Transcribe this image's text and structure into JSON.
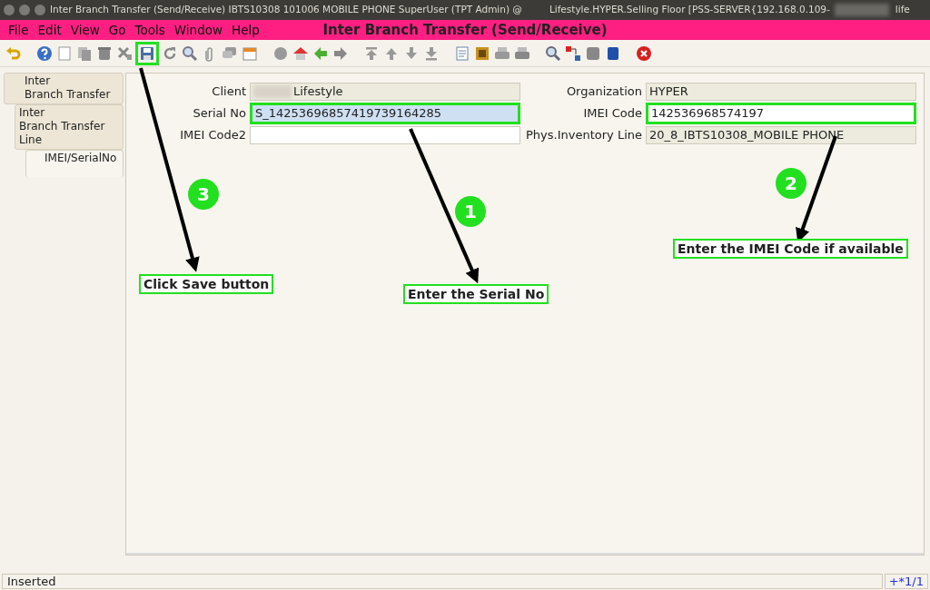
{
  "window": {
    "title": "Inter Branch Transfer (Send/Receive)  IBTS10308  101006  MOBILE PHONE  SuperUser (TPT Admin) @",
    "title_right": "Lifestyle.HYPER.Selling Floor [PSS-SERVER{192.168.0.109-",
    "title_tail": "life"
  },
  "menu": [
    "File",
    "Edit",
    "View",
    "Go",
    "Tools",
    "Window",
    "Help"
  ],
  "header": "Inter Branch Transfer (Send/Receive)",
  "toolbar": {
    "save_highlighted": true
  },
  "tabs": [
    {
      "label": "Inter\nBranch Transfer",
      "selected": false,
      "children": [
        {
          "label": "Inter\nBranch Transfer Line",
          "selected": false,
          "children": [
            {
              "label": "IMEI/SerialNo",
              "selected": true
            }
          ]
        }
      ]
    }
  ],
  "rows": [
    [
      {
        "label": "Client",
        "value": "Lifestyle",
        "editable": false,
        "focused": false,
        "highlighted": false,
        "redacted": true
      },
      {
        "label": "Organization",
        "value": "HYPER",
        "editable": false,
        "focused": false,
        "highlighted": false,
        "redacted": false
      }
    ],
    [
      {
        "label": "Serial No",
        "value": "S_14253696857419739164285",
        "editable": true,
        "focused": true,
        "highlighted": true,
        "redacted": false
      },
      {
        "label": "IMEI Code",
        "value": "142536968574197",
        "editable": true,
        "focused": false,
        "highlighted": true,
        "redacted": false
      }
    ],
    [
      {
        "label": "IMEI Code2",
        "editable": true,
        "focused": false,
        "highlighted": false,
        "redacted": false
      },
      {
        "label": "Phys.Inventory Line",
        "value": "20_8_IBTS10308_MOBILE PHONE",
        "editable": false,
        "focused": false,
        "highlighted": false,
        "redacted": false
      }
    ]
  ],
  "annotations": [
    {
      "number": "3",
      "text": "Click Save button"
    },
    {
      "number": "1",
      "text": "Enter the Serial No"
    },
    {
      "number": "2",
      "text": "Enter the IMEI Code if available"
    }
  ],
  "status_bar": {
    "message": "Inserted",
    "record": "+*1/1"
  }
}
